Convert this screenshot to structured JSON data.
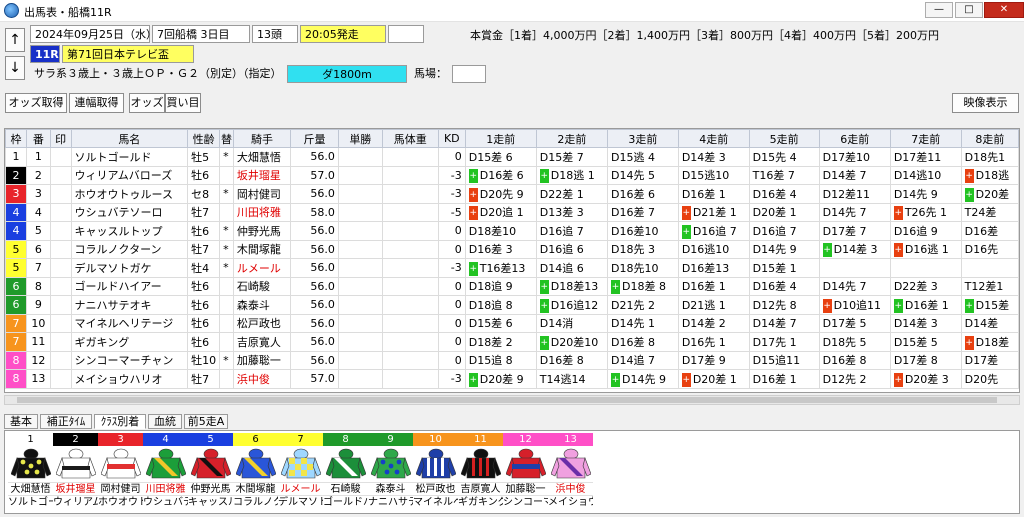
{
  "window": {
    "title": "出馬表・船橋11R",
    "min": "—",
    "max": "□",
    "close": "✕"
  },
  "race": {
    "date": "2024年09月25日（水）",
    "kai": "7回船橋 3日目",
    "heads": "13頭",
    "start": "20:05発走",
    "blank": "",
    "rno": "11R",
    "name": "第71回日本テレビ盃",
    "cond": "サラ系３歳上・３歳上ＯＰ・Ｇ２（別定）（指定）",
    "dist": "ダ1800m",
    "baba_label": "馬場：",
    "baba": ""
  },
  "prize": "本賞金［1着］4,000万円［2着］1,400万円［3着］800万円［4着］400万円［5着］200万円",
  "toolbar": {
    "odds": "オッズ取得",
    "renpuku": "連幅取得",
    "odds2": "オッズ",
    "kaime": "買い目",
    "video": "映像表示"
  },
  "headers": [
    "枠",
    "番",
    "印",
    "馬名",
    "性齢",
    "替",
    "騎手",
    "斤量",
    "単勝",
    "馬体重",
    "KD",
    "1走前",
    "2走前",
    "3走前",
    "4走前",
    "5走前",
    "6走前",
    "7走前",
    "8走前"
  ],
  "horses": [
    {
      "waku": "1",
      "wc": "#ffffff",
      "wt": "#000",
      "ban": "1",
      "name": "ソルトゴールド",
      "sa": "牡5",
      "ch": "*",
      "jockey": "大畑慧悟",
      "jr": false,
      "kin": "56.0",
      "kd": "0",
      "r": [
        "D15差 6",
        "D15差 7",
        "D15逃 4",
        "D14差 3",
        "D15先 4",
        "D17差10",
        "D17差11",
        "D18先1"
      ],
      "m": [
        "",
        "",
        "",
        "",
        "",
        "",
        "",
        ""
      ]
    },
    {
      "waku": "2",
      "wc": "#000000",
      "wt": "#fff",
      "ban": "2",
      "name": "ウィリアムバローズ",
      "sa": "牡6",
      "ch": "",
      "jockey": "坂井瑠星",
      "jr": true,
      "kin": "57.0",
      "kd": "-3",
      "r": [
        "D16差 6",
        "D18逃 1",
        "D14先 5",
        "D15逃10",
        "T16差 7",
        "D14差 7",
        "D14逃10",
        "D18逃"
      ],
      "m": [
        "g",
        "g",
        "",
        "",
        "",
        "",
        "",
        "r"
      ]
    },
    {
      "waku": "3",
      "wc": "#e8242a",
      "wt": "#fff",
      "ban": "3",
      "name": "ホウオウトゥルース",
      "sa": "セ8",
      "ch": "*",
      "jockey": "岡村健司",
      "jr": false,
      "kin": "56.0",
      "kd": "-3",
      "r": [
        "D20先 9",
        "D22差 1",
        "D16差 6",
        "D16差 1",
        "D16差 4",
        "D12差11",
        "D14先 9",
        "D20差"
      ],
      "m": [
        "r",
        "",
        "",
        "",
        "",
        "",
        "",
        "g"
      ]
    },
    {
      "waku": "4",
      "wc": "#1a3fe0",
      "wt": "#fff",
      "ban": "4",
      "name": "ウシュバテソーロ",
      "sa": "牡7",
      "ch": "",
      "jockey": "川田将雅",
      "jr": true,
      "kin": "58.0",
      "kd": "-5",
      "r": [
        "D20追 1",
        "D13差 3",
        "D16差 7",
        "D21差 1",
        "D20差 1",
        "D14先 7",
        "T26先 1",
        "T24差"
      ],
      "m": [
        "r",
        "",
        "",
        "r",
        "",
        "",
        "r",
        ""
      ]
    },
    {
      "waku": "4",
      "wc": "#1a3fe0",
      "wt": "#fff",
      "ban": "5",
      "name": "キャッスルトップ",
      "sa": "牡6",
      "ch": "*",
      "jockey": "仲野光馬",
      "jr": false,
      "kin": "56.0",
      "kd": "0",
      "r": [
        "D18差10",
        "D16追 7",
        "D16差10",
        "D16追 7",
        "D16追 7",
        "D17差 7",
        "D16追 9",
        "D16差"
      ],
      "m": [
        "",
        "",
        "",
        "g",
        "",
        "",
        "",
        ""
      ]
    },
    {
      "waku": "5",
      "wc": "#ffff30",
      "wt": "#000",
      "ban": "6",
      "name": "コラルノクターン",
      "sa": "牡7",
      "ch": "*",
      "jockey": "木間塚龍",
      "jr": false,
      "kin": "56.0",
      "kd": "0",
      "r": [
        "D16差 3",
        "D16追 6",
        "D18先 3",
        "D16逃10",
        "D14先 9",
        "D14差 3",
        "D16逃 1",
        "D16先"
      ],
      "m": [
        "",
        "",
        "",
        "",
        "",
        "g",
        "r",
        ""
      ]
    },
    {
      "waku": "5",
      "wc": "#ffff30",
      "wt": "#000",
      "ban": "7",
      "name": "デルマソトガケ",
      "sa": "牡4",
      "ch": "*",
      "jockey": "ルメール",
      "jr": true,
      "kin": "56.0",
      "kd": "-3",
      "r": [
        "T16差13",
        "D14追 6",
        "D18先10",
        "D16差13",
        "D15差 1",
        "",
        "",
        ""
      ],
      "m": [
        "g",
        "",
        "",
        "",
        "",
        "",
        "",
        ""
      ]
    },
    {
      "waku": "6",
      "wc": "#1f9a2a",
      "wt": "#fff",
      "ban": "8",
      "name": "ゴールドハイアー",
      "sa": "牡6",
      "ch": "",
      "jockey": "石崎駿",
      "jr": false,
      "kin": "56.0",
      "kd": "0",
      "r": [
        "D18追 9",
        "D18差13",
        "D18差 8",
        "D16差 1",
        "D16差 4",
        "D14先 7",
        "D22差 3",
        "T12差1"
      ],
      "m": [
        "",
        "g",
        "g",
        "",
        "",
        "",
        "",
        ""
      ]
    },
    {
      "waku": "6",
      "wc": "#1f9a2a",
      "wt": "#fff",
      "ban": "9",
      "name": "ナニハサテオキ",
      "sa": "牡6",
      "ch": "",
      "jockey": "森泰斗",
      "jr": false,
      "kin": "56.0",
      "kd": "0",
      "r": [
        "D18追 8",
        "D16追12",
        "D21先 2",
        "D21逃 1",
        "D12先 8",
        "D10追11",
        "D16差 1",
        "D15差"
      ],
      "m": [
        "",
        "g",
        "",
        "",
        "",
        "r",
        "g",
        "g"
      ]
    },
    {
      "waku": "7",
      "wc": "#f7941d",
      "wt": "#fff",
      "ban": "10",
      "name": "マイネルヘリテージ",
      "sa": "牡6",
      "ch": "",
      "jockey": "松戸政也",
      "jr": false,
      "kin": "56.0",
      "kd": "0",
      "r": [
        "D15差 6",
        "D14消",
        "D14先 1",
        "D14差 2",
        "D14差 7",
        "D17差 5",
        "D14差 3",
        "D14差"
      ],
      "m": [
        "",
        "",
        "",
        "",
        "",
        "",
        "",
        ""
      ]
    },
    {
      "waku": "7",
      "wc": "#f7941d",
      "wt": "#fff",
      "ban": "11",
      "name": "ギガキング",
      "sa": "牡6",
      "ch": "",
      "jockey": "吉原寛人",
      "jr": false,
      "kin": "56.0",
      "kd": "0",
      "r": [
        "D18差 2",
        "D20差10",
        "D16差 8",
        "D16先 1",
        "D17先 1",
        "D18先 5",
        "D15差 5",
        "D18差"
      ],
      "m": [
        "",
        "g",
        "",
        "",
        "",
        "",
        "",
        "r"
      ]
    },
    {
      "waku": "8",
      "wc": "#ff4fc7",
      "wt": "#fff",
      "ban": "12",
      "name": "シンコーマーチャン",
      "sa": "牡10",
      "ch": "*",
      "jockey": "加藤聡一",
      "jr": false,
      "kin": "56.0",
      "kd": "0",
      "r": [
        "D15追 8",
        "D16差 8",
        "D14追 7",
        "D17差 9",
        "D15追11",
        "D16差 8",
        "D17差 8",
        "D17差"
      ],
      "m": [
        "",
        "",
        "",
        "",
        "",
        "",
        "",
        ""
      ]
    },
    {
      "waku": "8",
      "wc": "#ff4fc7",
      "wt": "#fff",
      "ban": "13",
      "name": "メイショウハリオ",
      "sa": "牡7",
      "ch": "",
      "jockey": "浜中俊",
      "jr": true,
      "kin": "57.0",
      "kd": "-3",
      "r": [
        "D20差 9",
        "T14逃14",
        "D14先 9",
        "D20差 1",
        "D16差 1",
        "D12先 2",
        "D20差 3",
        "D20先"
      ],
      "m": [
        "g",
        "",
        "g",
        "r",
        "",
        "",
        "r",
        ""
      ]
    }
  ],
  "tabs": [
    "基本",
    "補正ﾀｲﾑ",
    "ｸﾗｽ別着",
    "血統",
    "前5走A"
  ],
  "silks": [
    {
      "no": "1",
      "bg": "#ffffff",
      "fg": "#000",
      "jockey": "大畑慧悟",
      "jr": false,
      "horse": "ソルトゴール",
      "c1": "#111111",
      "c2": "#e6e64a",
      "pat": "dot"
    },
    {
      "no": "2",
      "bg": "#000000",
      "fg": "#fff",
      "jockey": "坂井瑠星",
      "jr": true,
      "horse": "ウィリアム",
      "c1": "#ffffff",
      "c2": "#1a1a1a",
      "pat": "ring"
    },
    {
      "no": "3",
      "bg": "#e8242a",
      "fg": "#fff",
      "jockey": "岡村健司",
      "jr": false,
      "horse": "ホウオウト",
      "c1": "#ffffff",
      "c2": "#e23030",
      "pat": "band"
    },
    {
      "no": "4",
      "bg": "#1a3fe0",
      "fg": "#fff",
      "jockey": "川田将雅",
      "jr": true,
      "horse": "ウシュバテ",
      "c1": "#1c9e3a",
      "c2": "#f2c62a",
      "pat": "sash"
    },
    {
      "no": "5",
      "bg": "#1a3fe0",
      "fg": "#fff",
      "jockey": "仲野光馬",
      "jr": false,
      "horse": "キャッスル",
      "c1": "#d6202a",
      "c2": "#101010",
      "pat": "sash"
    },
    {
      "no": "6",
      "bg": "#ffff30",
      "fg": "#000",
      "jockey": "木間塚龍",
      "jr": false,
      "horse": "コラルノク",
      "c1": "#2a56d8",
      "c2": "#f2d12a",
      "pat": "sash"
    },
    {
      "no": "7",
      "bg": "#ffff30",
      "fg": "#000",
      "jockey": "ルメール",
      "jr": true,
      "horse": "デルマソト",
      "c1": "#9fd7ff",
      "c2": "#f2e54a",
      "pat": "check"
    },
    {
      "no": "8",
      "bg": "#1f9a2a",
      "fg": "#fff",
      "jockey": "石崎駿",
      "jr": false,
      "horse": "ゴールドハ",
      "c1": "#1c8f3a",
      "c2": "#ffffff",
      "pat": "sash"
    },
    {
      "no": "9",
      "bg": "#1f9a2a",
      "fg": "#fff",
      "jockey": "森泰斗",
      "jr": false,
      "horse": "ナニハサテ",
      "c1": "#2fa84a",
      "c2": "#1540c8",
      "pat": "dot"
    },
    {
      "no": "10",
      "bg": "#f7941d",
      "fg": "#fff",
      "jockey": "松戸政也",
      "jr": false,
      "horse": "マイネルヘ",
      "c1": "#1f3fa8",
      "c2": "#ffffff",
      "pat": "stripe"
    },
    {
      "no": "11",
      "bg": "#f7941d",
      "fg": "#fff",
      "jockey": "吉原寛人",
      "jr": false,
      "horse": "ギガキング",
      "c1": "#101010",
      "c2": "#d62020",
      "pat": "stripe"
    },
    {
      "no": "12",
      "bg": "#ff4fc7",
      "fg": "#fff",
      "jockey": "加藤聡一",
      "jr": false,
      "horse": "シンコーマ",
      "c1": "#d6202a",
      "c2": "#1f3fa8",
      "pat": "band"
    },
    {
      "no": "13",
      "bg": "#ff4fc7",
      "fg": "#fff",
      "jockey": "浜中俊",
      "jr": true,
      "horse": "メイショウ",
      "c1": "#f0a0e0",
      "c2": "#6a2ea8",
      "pat": "sash"
    }
  ]
}
